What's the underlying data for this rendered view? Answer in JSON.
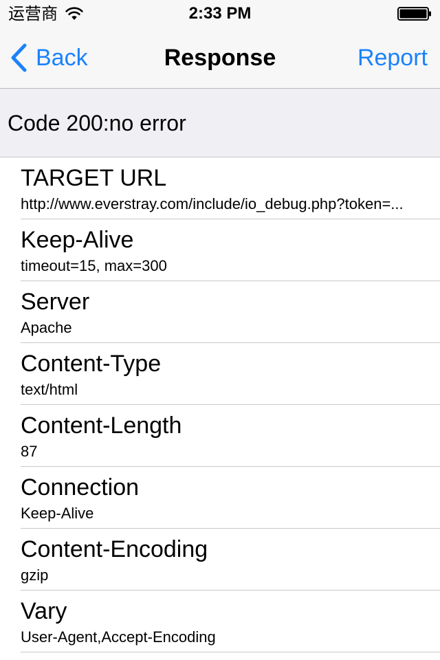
{
  "status_bar": {
    "carrier": "运营商",
    "time": "2:33 PM"
  },
  "nav": {
    "back_label": "Back",
    "title": "Response",
    "report_label": "Report"
  },
  "section_header": "Code 200:no error",
  "headers": [
    {
      "title": "TARGET URL",
      "value": "http://www.everstray.com/include/io_debug.php?token=..."
    },
    {
      "title": "Keep-Alive",
      "value": "timeout=15, max=300"
    },
    {
      "title": "Server",
      "value": "Apache"
    },
    {
      "title": "Content-Type",
      "value": "text/html"
    },
    {
      "title": "Content-Length",
      "value": "87"
    },
    {
      "title": "Connection",
      "value": "Keep-Alive"
    },
    {
      "title": "Content-Encoding",
      "value": "gzip"
    },
    {
      "title": "Vary",
      "value": "User-Agent,Accept-Encoding"
    }
  ],
  "colors": {
    "accent": "#1a82fb",
    "section_bg": "#efeff4",
    "separator": "#c8c7cc"
  },
  "icons": [
    "wifi-icon",
    "battery-icon",
    "back-chevron-icon"
  ]
}
